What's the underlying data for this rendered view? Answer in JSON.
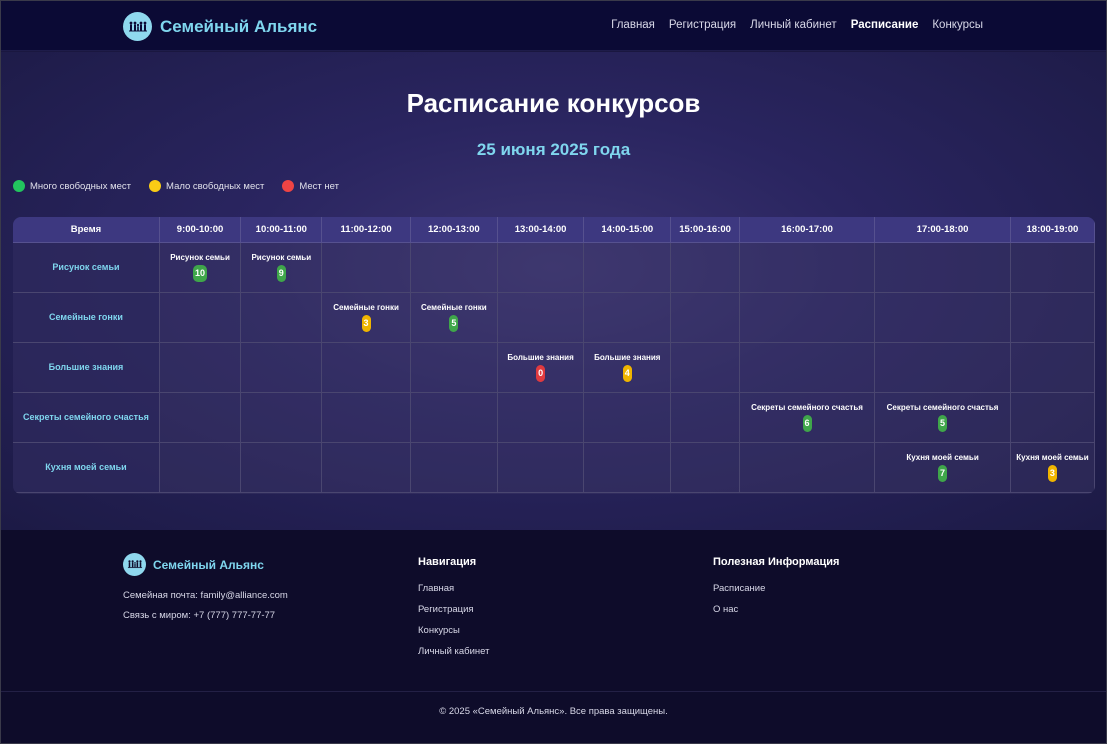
{
  "header": {
    "brand": "Семейный Альянс",
    "nav": [
      {
        "label": "Главная",
        "active": false
      },
      {
        "label": "Регистрация",
        "active": false
      },
      {
        "label": "Личный кабинет",
        "active": false
      },
      {
        "label": "Расписание",
        "active": true
      },
      {
        "label": "Конкурсы",
        "active": false
      }
    ]
  },
  "main": {
    "title": "Расписание конкурсов",
    "date": "25 июня 2025 года",
    "legend": [
      {
        "label": "Много свободных мест",
        "color": "#22c55e"
      },
      {
        "label": "Мало свободных мест",
        "color": "#facc15"
      },
      {
        "label": "Мест нет",
        "color": "#ef4444"
      }
    ],
    "table": {
      "corner": "Время",
      "slots": [
        "9:00-10:00",
        "10:00-11:00",
        "11:00-12:00",
        "12:00-13:00",
        "13:00-14:00",
        "14:00-15:00",
        "15:00-16:00",
        "16:00-17:00",
        "17:00-18:00",
        "18:00-19:00"
      ],
      "rows": [
        {
          "name": "Рисунок семьи",
          "events": [
            {
              "slot": 0,
              "label": "Рисунок семьи",
              "count": "10",
              "status": "green"
            },
            {
              "slot": 1,
              "label": "Рисунок семьи",
              "count": "9",
              "status": "green"
            }
          ]
        },
        {
          "name": "Семейные гонки",
          "events": [
            {
              "slot": 2,
              "label": "Семейные гонки",
              "count": "3",
              "status": "yellow"
            },
            {
              "slot": 3,
              "label": "Семейные гонки",
              "count": "5",
              "status": "green"
            }
          ]
        },
        {
          "name": "Большие знания",
          "events": [
            {
              "slot": 4,
              "label": "Большие знания",
              "count": "0",
              "status": "red"
            },
            {
              "slot": 5,
              "label": "Большие знания",
              "count": "4",
              "status": "yellow"
            }
          ]
        },
        {
          "name": "Секреты семейного счастья",
          "events": [
            {
              "slot": 7,
              "label": "Секреты семейного счастья",
              "count": "6",
              "status": "green"
            },
            {
              "slot": 8,
              "label": "Секреты семейного счастья",
              "count": "5",
              "status": "green"
            }
          ]
        },
        {
          "name": "Кухня моей семьи",
          "events": [
            {
              "slot": 8,
              "label": "Кухня моей семьи",
              "count": "7",
              "status": "green"
            },
            {
              "slot": 9,
              "label": "Кухня моей семьи",
              "count": "3",
              "status": "yellow"
            }
          ]
        }
      ]
    }
  },
  "footer": {
    "brand": "Семейный Альянс",
    "email": "Семейная почта: family@alliance.com",
    "phone": "Связь с миром: +7 (777) 777-77-77",
    "nav_title": "Навигация",
    "nav_links": [
      "Главная",
      "Регистрация",
      "Конкурсы",
      "Личный кабинет"
    ],
    "info_title": "Полезная Информация",
    "info_links": [
      "Расписание",
      "О нас"
    ],
    "copyright": "© 2025 «Семейный Альянс». Все права защищены."
  }
}
